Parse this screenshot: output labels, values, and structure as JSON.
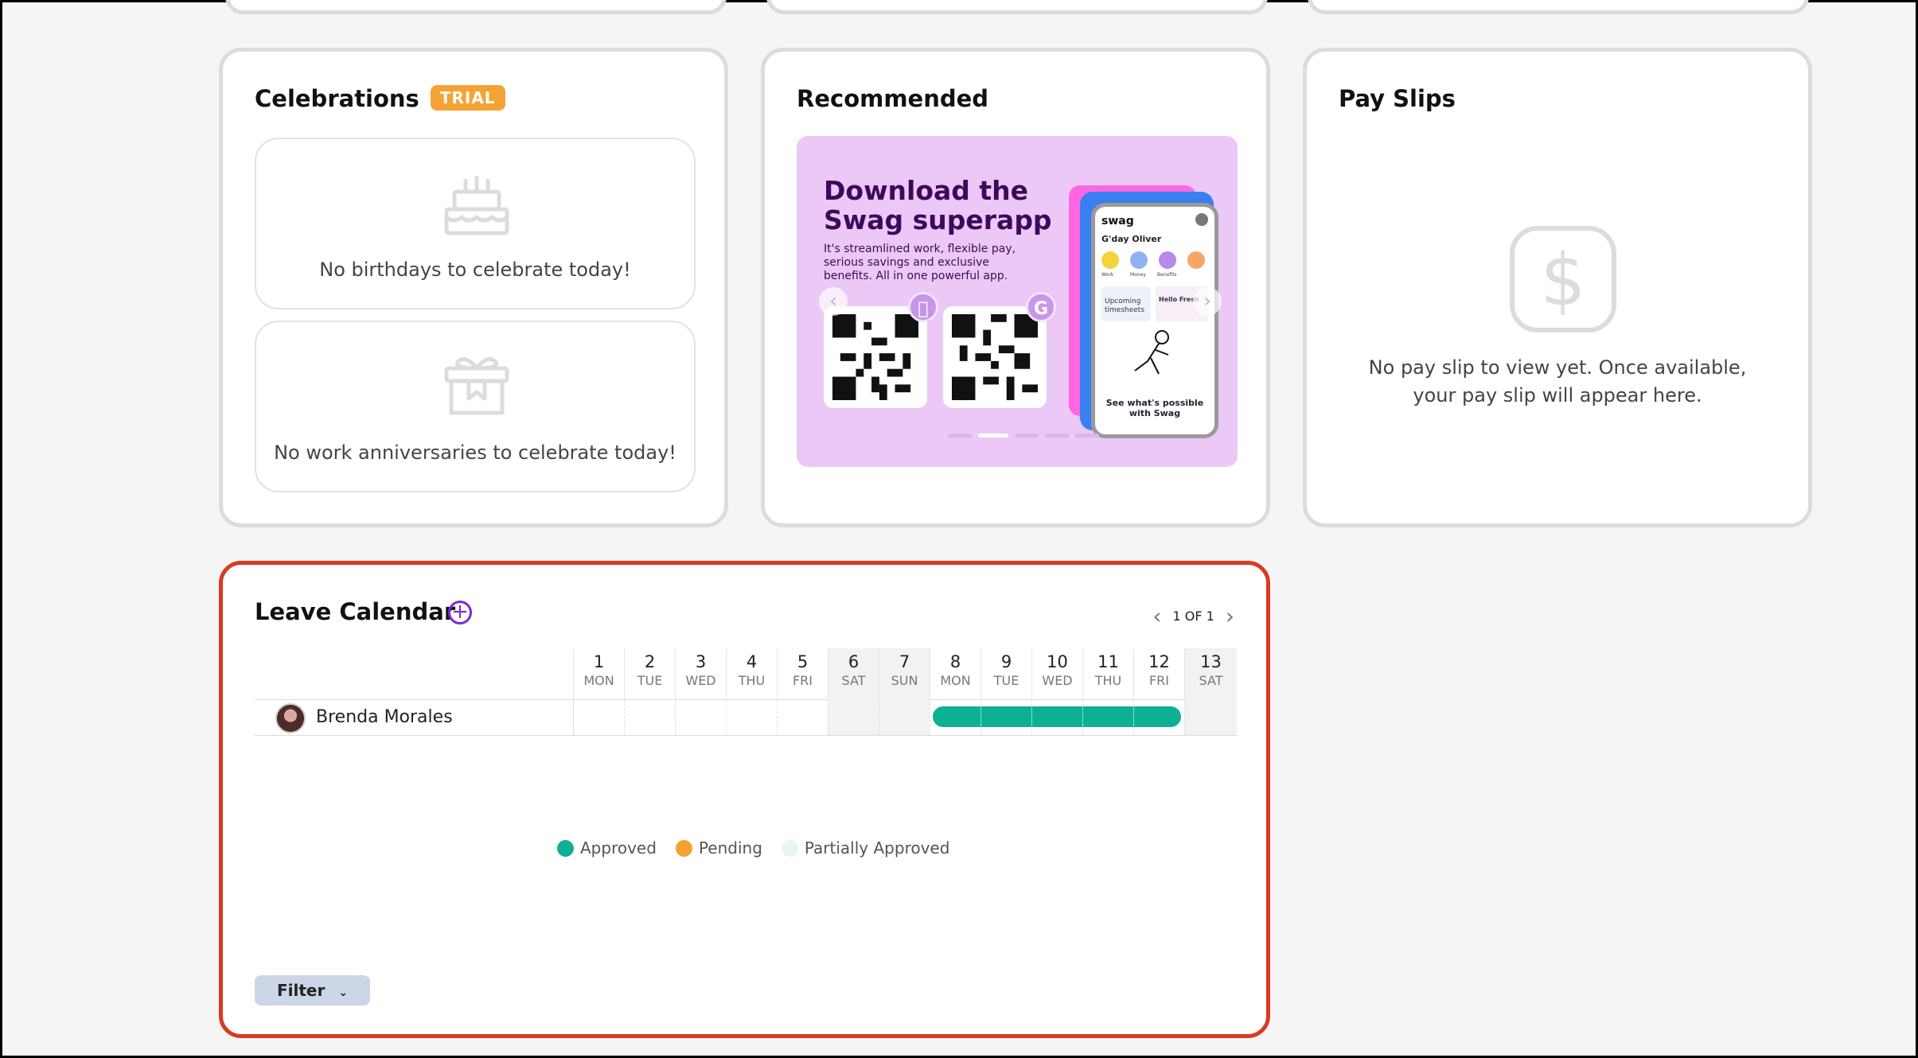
{
  "celebrations": {
    "title": "Celebrations",
    "badge": "TRIAL",
    "birthdays_msg": "No birthdays to celebrate today!",
    "anniversaries_msg": "No work anniversaries to celebrate today!"
  },
  "recommended": {
    "title": "Recommended",
    "headline_line1": "Download the",
    "headline_line2": "Swag superapp",
    "sub": "It's streamlined work, flexible pay, serious savings and exclusive benefits. All in one powerful app.",
    "phone": {
      "brand": "swag",
      "greeting": "G'day Oliver",
      "shortcuts": [
        "Work",
        "Money",
        "Benefits"
      ],
      "tile1": "Upcoming timesheets",
      "tile2": "Hello Fresh",
      "cta": "See what's possible with Swag"
    },
    "apple_badge": "",
    "google_badge": "G"
  },
  "payslips": {
    "title": "Pay Slips",
    "empty_msg": "No pay slip to view yet. Once available, your pay slip will appear here."
  },
  "leave_calendar": {
    "title": "Leave Calendar",
    "pager": "1 OF 1",
    "days": [
      {
        "num": "1",
        "dow": "MON"
      },
      {
        "num": "2",
        "dow": "TUE"
      },
      {
        "num": "3",
        "dow": "WED"
      },
      {
        "num": "4",
        "dow": "THU"
      },
      {
        "num": "5",
        "dow": "FRI"
      },
      {
        "num": "6",
        "dow": "SAT"
      },
      {
        "num": "7",
        "dow": "SUN"
      },
      {
        "num": "8",
        "dow": "MON"
      },
      {
        "num": "9",
        "dow": "TUE"
      },
      {
        "num": "10",
        "dow": "WED"
      },
      {
        "num": "11",
        "dow": "THU"
      },
      {
        "num": "12",
        "dow": "FRI"
      },
      {
        "num": "13",
        "dow": "SAT"
      }
    ],
    "employee": "Brenda Morales",
    "legend": {
      "approved": "Approved",
      "pending": "Pending",
      "partial": "Partially Approved"
    },
    "filter": "Filter"
  },
  "colors": {
    "accent": "#7d2bd8",
    "approved": "#0db095",
    "pending": "#f5a234",
    "partial": "#e6f6f1",
    "highlight_border": "#d93a22"
  }
}
